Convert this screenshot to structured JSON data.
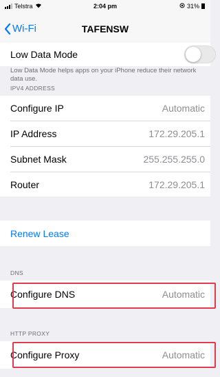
{
  "status_bar": {
    "carrier": "Telstra",
    "time": "2:04 pm",
    "battery": "31%"
  },
  "nav": {
    "back_label": "Wi-Fi",
    "title": "TAFENSW"
  },
  "low_data": {
    "label": "Low Data Mode",
    "enabled": false,
    "note": "Low Data Mode helps apps on your iPhone reduce their network data use."
  },
  "ipv4": {
    "header": "IPV4 ADDRESS",
    "rows": [
      {
        "label": "Configure IP",
        "value": "Automatic"
      },
      {
        "label": "IP Address",
        "value": "172.29.205.1"
      },
      {
        "label": "Subnet Mask",
        "value": "255.255.255.0"
      },
      {
        "label": "Router",
        "value": "172.29.205.1"
      }
    ]
  },
  "renew": {
    "label": "Renew Lease"
  },
  "dns": {
    "header": "DNS",
    "label": "Configure DNS",
    "value": "Automatic"
  },
  "proxy": {
    "header": "HTTP PROXY",
    "label": "Configure Proxy",
    "value": "Automatic"
  },
  "colors": {
    "accent": "#007aff",
    "highlight": "#e03a4b"
  }
}
